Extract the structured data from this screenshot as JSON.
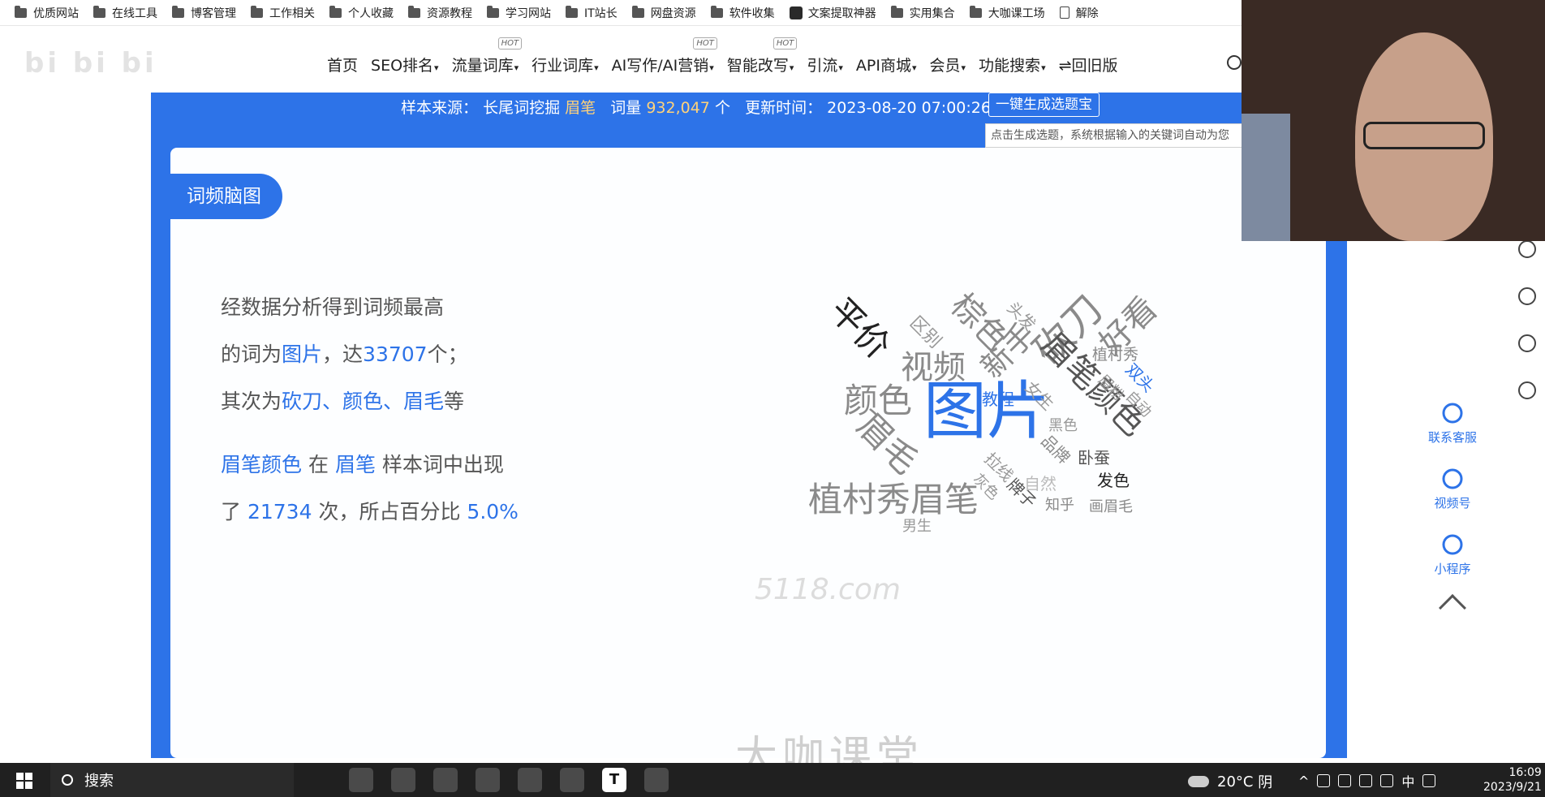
{
  "bookmarks": [
    {
      "label": "优质网站",
      "icon": "folder-icon"
    },
    {
      "label": "在线工具",
      "icon": "folder-icon"
    },
    {
      "label": "博客管理",
      "icon": "folder-icon"
    },
    {
      "label": "工作相关",
      "icon": "folder-icon"
    },
    {
      "label": "个人收藏",
      "icon": "folder-icon"
    },
    {
      "label": "资源教程",
      "icon": "folder-icon"
    },
    {
      "label": "学习网站",
      "icon": "folder-icon"
    },
    {
      "label": "IT站长",
      "icon": "folder-icon"
    },
    {
      "label": "网盘资源",
      "icon": "folder-icon"
    },
    {
      "label": "软件收集",
      "icon": "folder-icon"
    },
    {
      "label": "文案提取神器",
      "icon": "app-icon"
    },
    {
      "label": "实用集合",
      "icon": "folder-icon"
    },
    {
      "label": "大咖课工场",
      "icon": "folder-icon"
    },
    {
      "label": "解除",
      "icon": "doc-icon"
    }
  ],
  "nav": {
    "items": [
      {
        "label": "首页",
        "caret": false,
        "hot": false
      },
      {
        "label": "SEO排名",
        "caret": true,
        "hot": false
      },
      {
        "label": "流量词库",
        "caret": true,
        "hot": true
      },
      {
        "label": "行业词库",
        "caret": true,
        "hot": false
      },
      {
        "label": "AI写作/AI营销",
        "caret": true,
        "hot": true
      },
      {
        "label": "智能改写",
        "caret": true,
        "hot": true
      },
      {
        "label": "引流",
        "caret": true,
        "hot": false
      },
      {
        "label": "API商城",
        "caret": true,
        "hot": false
      },
      {
        "label": "会员",
        "caret": true,
        "hot": false
      },
      {
        "label": "功能搜索",
        "caret": true,
        "hot": false
      },
      {
        "label": "⇌回旧版",
        "caret": false,
        "hot": false
      }
    ],
    "hot_label": "HOT"
  },
  "infobar": {
    "source_label": "样本来源：",
    "source_value": "长尾词挖掘",
    "keyword": "眉笔",
    "count_label": "词量",
    "count_value": "932,047",
    "count_unit": "个",
    "update_label": "更新时间：",
    "update_value": "2023-08-20 07:00:26",
    "button": "一键生成选题宝",
    "tooltip": "点击生成选题，系统根据输入的关键词自动为您"
  },
  "card": {
    "tab_title": "词频脑图",
    "summary": {
      "line1": "经数据分析得到词频最高",
      "line2_pre": "的词为",
      "top_word": "图片",
      "line2_mid": "，达",
      "top_count": "33707",
      "line2_post": "个；",
      "line3_pre": "其次为",
      "second_words": "砍刀、颜色、眉毛",
      "line3_post": "等",
      "line4_word": "眉笔颜色",
      "line4_mid": "在",
      "line4_kw": "眉笔",
      "line4_post": "样本词中出现",
      "line5_pre": "了",
      "line5_count": "21734",
      "line5_mid": "次，所占百分比",
      "line5_pct": "5.0%"
    },
    "wordcloud": [
      {
        "text": "图片",
        "color": "#2d73e8"
      },
      {
        "text": "砍刀",
        "color": "#8a8a8a"
      },
      {
        "text": "颜色",
        "color": "#8a8a8a"
      },
      {
        "text": "眉毛",
        "color": "#8a8a8a"
      },
      {
        "text": "眉笔颜色",
        "color": "#555555"
      },
      {
        "text": "植村秀眉笔",
        "color": "#8a8a8a"
      },
      {
        "text": "平价",
        "color": "#222222"
      },
      {
        "text": "棕色",
        "color": "#8a8a8a"
      },
      {
        "text": "好看",
        "color": "#8a8a8a"
      },
      {
        "text": "视频",
        "color": "#8a8a8a"
      },
      {
        "text": "新手",
        "color": "#8a8a8a"
      },
      {
        "text": "区别",
        "color": "#999999"
      },
      {
        "text": "头发",
        "color": "#999999"
      },
      {
        "text": "植村秀",
        "color": "#8a8a8a"
      },
      {
        "text": "教程",
        "color": "#2d73e8"
      },
      {
        "text": "女生",
        "color": "#999999"
      },
      {
        "text": "眉粉",
        "color": "#999999"
      },
      {
        "text": "双头",
        "color": "#2d73e8"
      },
      {
        "text": "自动",
        "color": "#999999"
      },
      {
        "text": "黑色",
        "color": "#999999"
      },
      {
        "text": "品牌",
        "color": "#8a8a8a"
      },
      {
        "text": "卧蚕",
        "color": "#555555"
      },
      {
        "text": "发色",
        "color": "#222222"
      },
      {
        "text": "拉线",
        "color": "#999999"
      },
      {
        "text": "自然",
        "color": "#bbbbbb"
      },
      {
        "text": "灰色",
        "color": "#999999"
      },
      {
        "text": "牌子",
        "color": "#555555"
      },
      {
        "text": "知乎",
        "color": "#8a8a8a"
      },
      {
        "text": "画眉毛",
        "color": "#8a8a8a"
      },
      {
        "text": "男生",
        "color": "#999999"
      }
    ],
    "watermark": "5118.com",
    "bottom_watermark": "大咖课堂"
  },
  "float_panel": [
    {
      "label": "联系客服",
      "icon": "headset-icon"
    },
    {
      "label": "视频号",
      "icon": "video-icon"
    },
    {
      "label": "小程序",
      "icon": "miniprogram-icon"
    }
  ],
  "taskbar": {
    "search_label": "搜索",
    "apps": [
      "",
      "",
      "",
      "",
      "",
      "",
      "T",
      ""
    ],
    "weather_temp": "20°C",
    "weather_text": "阴",
    "ime": "中",
    "time": "16:09",
    "date": "2023/9/21"
  },
  "colors": {
    "accent": "#2d73e8",
    "highlight": "#ffd27a",
    "taskbar": "#202020"
  }
}
